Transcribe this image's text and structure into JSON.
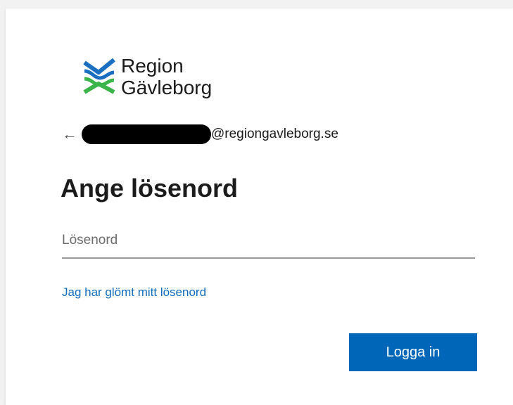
{
  "logo": {
    "line1": "Region",
    "line2": "Gävleborg",
    "colors": {
      "blue": "#1a6fc0",
      "green": "#3bb54a"
    }
  },
  "identity": {
    "back_icon": "arrow-left-icon",
    "email_domain": "@regiongavleborg.se"
  },
  "title": "Ange lösenord",
  "password": {
    "placeholder": "Lösenord",
    "value": ""
  },
  "forgot_link": "Jag har glömt mitt lösenord",
  "signin_button": "Logga in",
  "colors": {
    "accent": "#0067b8",
    "link": "#0f6cbd"
  }
}
